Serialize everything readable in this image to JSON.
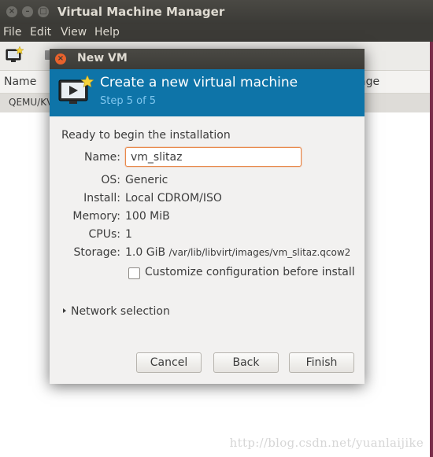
{
  "main_window": {
    "title": "Virtual Machine Manager",
    "menu": [
      "File",
      "Edit",
      "View",
      "Help"
    ],
    "list_columns": [
      "Name",
      "age"
    ],
    "list_rows": [
      "QEMU/KV"
    ]
  },
  "dialog": {
    "title": "New VM",
    "header": {
      "title": "Create a new virtual machine",
      "step": "Step 5 of 5"
    },
    "ready_text": "Ready to begin the installation",
    "fields": {
      "name_label": "Name:",
      "name_value": "vm_slitaz",
      "os_label": "OS:",
      "os_value": "Generic",
      "install_label": "Install:",
      "install_value": "Local CDROM/ISO",
      "memory_label": "Memory:",
      "memory_value": "100 MiB",
      "cpus_label": "CPUs:",
      "cpus_value": "1",
      "storage_label": "Storage:",
      "storage_size": "1.0 GiB",
      "storage_path": "/var/lib/libvirt/images/vm_slitaz.qcow2"
    },
    "customize_label": "Customize configuration before install",
    "customize_checked": false,
    "network_label": "Network selection",
    "buttons": {
      "cancel": "Cancel",
      "back": "Back",
      "finish": "Finish"
    }
  },
  "watermark": "http://blog.csdn.net/yuanlaijike",
  "colors": {
    "titlebar": "#3c3b37",
    "header_blue": "#0e74a8",
    "close_orange": "#e8622c",
    "input_focus": "#e8884a"
  }
}
